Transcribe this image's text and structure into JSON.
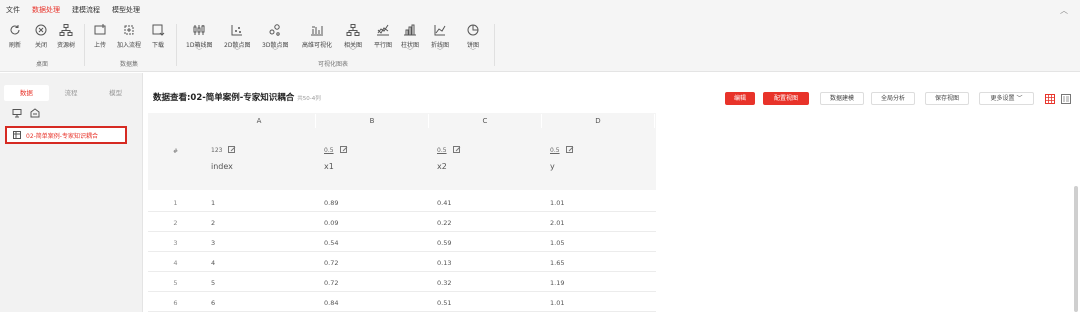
{
  "menu": [
    "文件",
    "数据处理",
    "建模流程",
    "模型处理"
  ],
  "ribbon": {
    "buttons": [
      {
        "label": "刷新",
        "icon": "refresh-icon"
      },
      {
        "label": "关闭",
        "icon": "close-circle-icon"
      },
      {
        "label": "资源树",
        "icon": "tree-icon"
      },
      {
        "label": "上传",
        "icon": "upload-icon"
      },
      {
        "label": "加入流程",
        "icon": "add-flow-icon"
      },
      {
        "label": "下载",
        "icon": "download-icon"
      },
      {
        "label": "1D箱线图",
        "icon": "boxplot-icon"
      },
      {
        "label": "2D散点图",
        "icon": "scatter-2d-icon"
      },
      {
        "label": "3D散点图",
        "icon": "scatter-3d-icon"
      },
      {
        "label": "高维可视化",
        "icon": "highdim-icon"
      },
      {
        "label": "相关图",
        "icon": "correlation-icon"
      },
      {
        "label": "平行图",
        "icon": "parallel-icon"
      },
      {
        "label": "柱状图",
        "icon": "bar-chart-icon"
      },
      {
        "label": "折线图",
        "icon": "line-chart-icon"
      },
      {
        "label": "饼图",
        "icon": "pie-chart-icon"
      }
    ],
    "groups": [
      "桌面",
      "数据集",
      "可视化图表"
    ]
  },
  "left": {
    "tabs": [
      "数据",
      "流程",
      "模型"
    ],
    "dataset_item": "02-简单案例-专家知识耦合"
  },
  "main": {
    "title": "数据查看:02-简单案例-专家知识耦合",
    "count": "共50-4列",
    "buttons": [
      "编辑",
      "配置视图",
      "数据建模",
      "全局分析",
      "保存视图",
      "更多设置 ﹀"
    ]
  },
  "table": {
    "row_header": "#",
    "columns": [
      {
        "letter": "A",
        "type": "123",
        "name": "index"
      },
      {
        "letter": "B",
        "type": "0.5",
        "name": "x1"
      },
      {
        "letter": "C",
        "type": "0.5",
        "name": "x2"
      },
      {
        "letter": "D",
        "type": "0.5",
        "name": "y"
      }
    ],
    "rows": [
      [
        "1",
        "1",
        "0.89",
        "0.41",
        "1.01"
      ],
      [
        "2",
        "2",
        "0.09",
        "0.22",
        "2.01"
      ],
      [
        "3",
        "3",
        "0.54",
        "0.59",
        "1.05"
      ],
      [
        "4",
        "4",
        "0.72",
        "0.13",
        "1.65"
      ],
      [
        "5",
        "5",
        "0.72",
        "0.32",
        "1.19"
      ],
      [
        "6",
        "6",
        "0.84",
        "0.51",
        "1.01"
      ]
    ]
  },
  "colors": {
    "accent": "#e8332a",
    "highlight_border": "#d62a22"
  }
}
